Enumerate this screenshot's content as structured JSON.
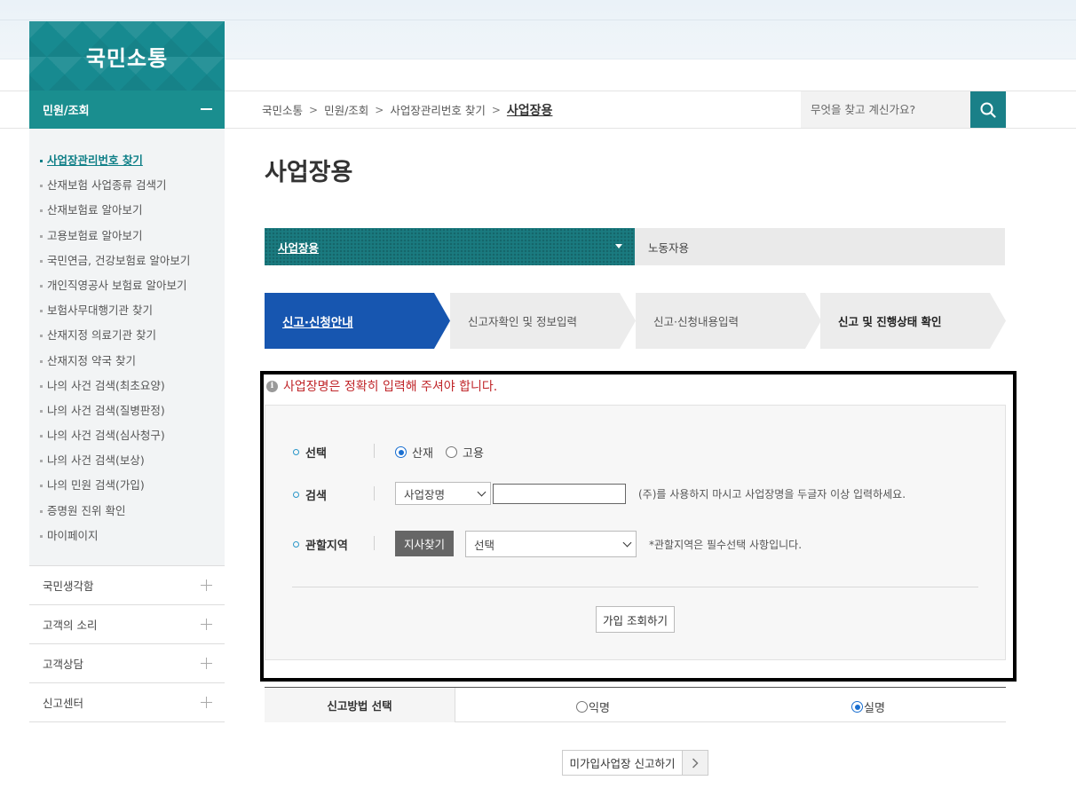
{
  "brand": {
    "title": "국민소통"
  },
  "sidebar": {
    "section_title": "민원/조회",
    "items": [
      {
        "label": "사업장관리번호 찾기",
        "active": true
      },
      {
        "label": "산재보험 사업종류 검색기"
      },
      {
        "label": "산재보험료 알아보기"
      },
      {
        "label": "고용보험료 알아보기"
      },
      {
        "label": "국민연금, 건강보험료 알아보기"
      },
      {
        "label": "개인직영공사 보험료 알아보기"
      },
      {
        "label": "보험사무대행기관 찾기"
      },
      {
        "label": "산재지정 의료기관 찾기"
      },
      {
        "label": "산재지정 약국 찾기"
      },
      {
        "label": "나의 사건 검색(최초요양)"
      },
      {
        "label": "나의 사건 검색(질병판정)"
      },
      {
        "label": "나의 사건 검색(심사청구)"
      },
      {
        "label": "나의 사건 검색(보상)"
      },
      {
        "label": "나의 민원 검색(가입)"
      },
      {
        "label": "증명원 진위 확인"
      },
      {
        "label": "마이페이지"
      }
    ],
    "accordions": [
      "국민생각함",
      "고객의 소리",
      "고객상담",
      "신고센터"
    ]
  },
  "breadcrumb": [
    "국민소통",
    "민원/조회",
    "사업장관리번호 찾기",
    "사업장용"
  ],
  "search": {
    "placeholder": "무엇을 찾고 계신가요?"
  },
  "page_title": "사업장용",
  "tabs": [
    {
      "label": "사업장용",
      "active": true
    },
    {
      "label": "노동자용"
    }
  ],
  "steps": [
    {
      "label": "신고·신청안내",
      "state": "active"
    },
    {
      "label": "신고자확인 및 정보입력"
    },
    {
      "label": "신고·신청내용입력"
    },
    {
      "label": "신고 및 진행상태 확인",
      "bold": true
    }
  ],
  "notice": "사업장명은 정확히 입력해 주셔야 합니다.",
  "form": {
    "select_label": "선택",
    "radio_sanjae": "산재",
    "radio_goyong": "고용",
    "search_label": "검색",
    "search_type": "사업장명",
    "search_value": "",
    "search_hint": "(주)를 사용하지 마시고 사업장명을 두글자 이상 입력하세요.",
    "region_label": "관할지역",
    "branch_button": "지사찾기",
    "region_select": "선택",
    "region_hint": "*관할지역은 필수선택 사항입니다.",
    "query_button": "가입 조회하기"
  },
  "method": {
    "label": "신고방법 선택",
    "anonymous": "익명",
    "named": "실명"
  },
  "report_button": "미가입사업장 신고하기",
  "colors": {
    "teal": "#1a8e8f",
    "step_active": "#1756b0",
    "notice_red": "#c0262a"
  }
}
